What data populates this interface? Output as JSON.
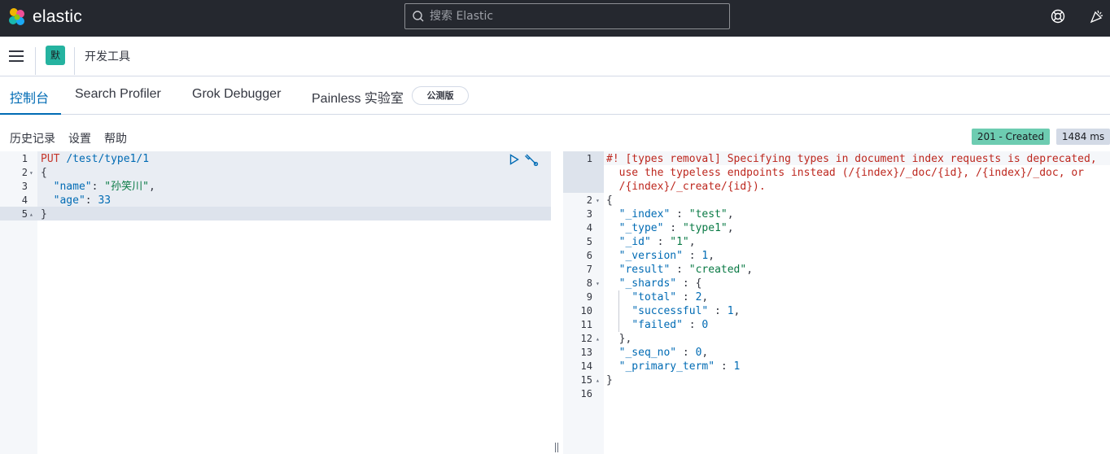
{
  "header": {
    "brand": "elastic",
    "search_placeholder": "搜索 Elastic",
    "icons": [
      "help-icon",
      "newsfeed-icon"
    ]
  },
  "nav": {
    "space_avatar": "默",
    "breadcrumb": "开发工具"
  },
  "tabs": [
    {
      "label": "控制台",
      "active": true
    },
    {
      "label": "Search Profiler",
      "active": false
    },
    {
      "label": "Grok Debugger",
      "active": false
    },
    {
      "label": "Painless 实验室",
      "active": false
    }
  ],
  "beta_badge": "公测版",
  "toolbar": {
    "history": "历史记录",
    "settings": "设置",
    "help": "帮助"
  },
  "status": {
    "code": "201 - Created",
    "time": "1484 ms"
  },
  "colors": {
    "header_bg": "#25282f",
    "accent": "#006bb4",
    "status_success": "#6dccb1"
  },
  "request": {
    "method": "PUT",
    "url": "/test/type1/1",
    "line_numbers": [
      "1",
      "2",
      "3",
      "4",
      "5"
    ],
    "lines": {
      "l2": "{",
      "l3_key": "\"name\"",
      "l3_val": "\"孙笑川\"",
      "l4_key": "\"age\"",
      "l4_val": "33",
      "l5": "}"
    }
  },
  "response": {
    "warning": [
      "#! [types removal] Specifying types in document index requests is deprecated,",
      "  use the typeless endpoints instead (/{index}/_doc/{id}, /{index}/_doc, or",
      "  /{index}/_create/{id})."
    ],
    "line_numbers": [
      "1",
      "2",
      "3",
      "4",
      "5",
      "6",
      "7",
      "8",
      "9",
      "10",
      "11",
      "12",
      "13",
      "14",
      "15",
      "16"
    ],
    "body": {
      "open": "{",
      "index_key": "\"_index\"",
      "index_val": "\"test\"",
      "type_key": "\"_type\"",
      "type_val": "\"type1\"",
      "id_key": "\"_id\"",
      "id_val": "\"1\"",
      "version_key": "\"_version\"",
      "version_val": "1",
      "result_key": "\"result\"",
      "result_val": "\"created\"",
      "shards_key": "\"_shards\"",
      "total_key": "\"total\"",
      "total_val": "2",
      "successful_key": "\"successful\"",
      "successful_val": "1",
      "failed_key": "\"failed\"",
      "failed_val": "0",
      "shards_close": "},",
      "seq_key": "\"_seq_no\"",
      "seq_val": "0",
      "term_key": "\"_primary_term\"",
      "term_val": "1",
      "close": "}"
    }
  }
}
